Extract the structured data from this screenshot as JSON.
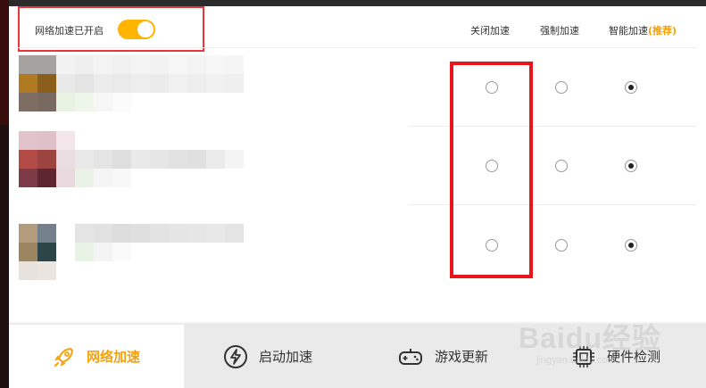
{
  "header": {
    "status_text": "网络加速已开启",
    "switch_on": true,
    "columns": {
      "off": "关闭加速",
      "force": "强制加速",
      "smart": "智能加速",
      "smart_tag": "(推荐)"
    }
  },
  "games": [
    {
      "mode": "smart"
    },
    {
      "mode": "smart"
    },
    {
      "mode": "smart"
    }
  ],
  "tabs": [
    {
      "label": "网络加速",
      "icon": "rocket-icon",
      "active": true
    },
    {
      "label": "启动加速",
      "icon": "lightning-icon",
      "active": false
    },
    {
      "label": "游戏更新",
      "icon": "gamepad-icon",
      "active": false
    },
    {
      "label": "硬件检测",
      "icon": "chip-icon",
      "active": false
    }
  ],
  "watermark": {
    "brand": "Baidu经验",
    "sub": "jingyan.baidu.com"
  },
  "colors": {
    "accent": "#f5a10a",
    "switch": "#ffb400",
    "annotation": "#e8161c"
  }
}
